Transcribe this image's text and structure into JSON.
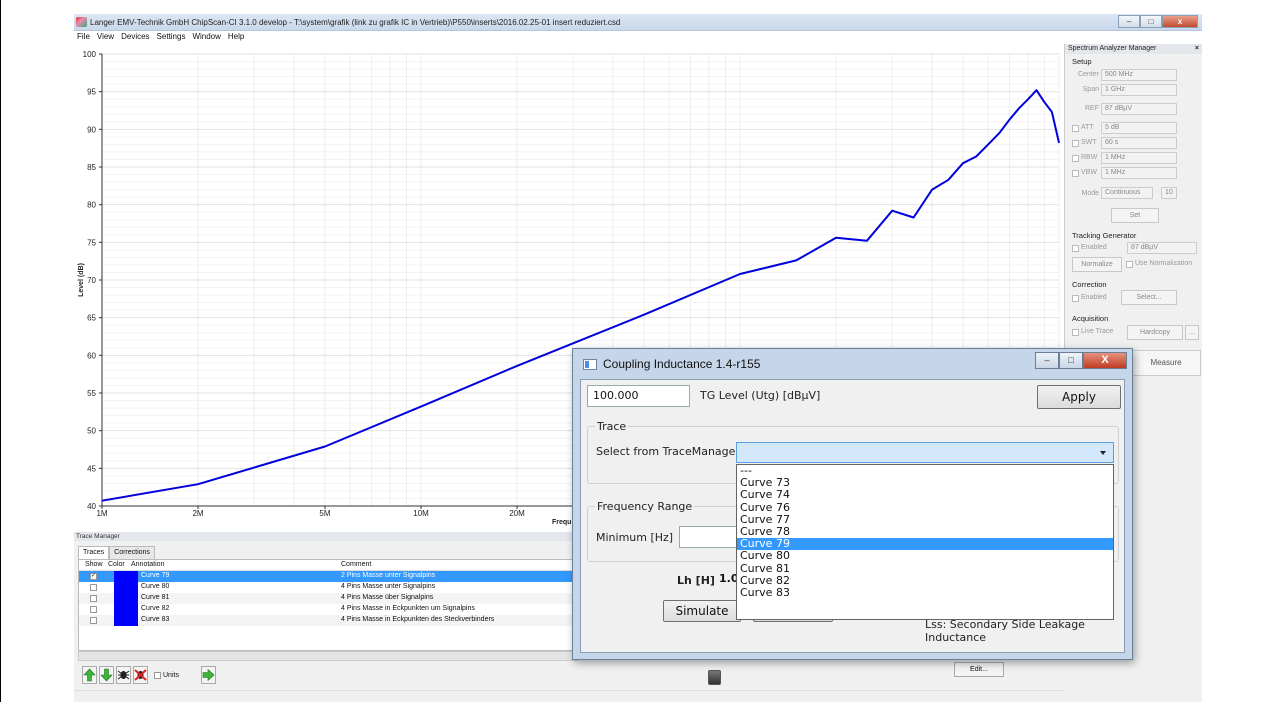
{
  "window": {
    "title": "Langer EMV-Technik GmbH ChipScan-CI 3.1.0 develop  -  T:\\system\\grafik (link zu grafik IC in Vertrieb)\\P550\\inserts\\2016.02.25-01 insert reduziert.csd",
    "buttons": {
      "minimize": "–",
      "maximize": "□",
      "close": "x"
    }
  },
  "menu": [
    "File",
    "View",
    "Devices",
    "Settings",
    "Window",
    "Help"
  ],
  "chart_data": {
    "type": "line",
    "ylabel": "Level (dB)",
    "xlabel": "Frequ",
    "ylim": [
      40,
      100
    ],
    "yticks": [
      40,
      45,
      50,
      55,
      60,
      65,
      70,
      75,
      80,
      85,
      90,
      95,
      100
    ],
    "xscale": "log",
    "xticks": [
      {
        "label": "1M",
        "value": 1000000
      },
      {
        "label": "2M",
        "value": 2000000
      },
      {
        "label": "5M",
        "value": 5000000
      },
      {
        "label": "10M",
        "value": 10000000
      },
      {
        "label": "20M",
        "value": 20000000
      }
    ],
    "grid": true,
    "line_color": "#0000dd",
    "series": [
      {
        "x": [
          1000000,
          2000000,
          5000000,
          10000000,
          20000000,
          50000000,
          100000000,
          150000000,
          200000000,
          250000000,
          300000000,
          350000000,
          400000000,
          450000000,
          500000000,
          550000000,
          600000000,
          650000000,
          700000000,
          750000000,
          800000000,
          850000000,
          900000000,
          950000000,
          1000000000
        ],
        "y": [
          40.7,
          42.9,
          47.9,
          53.2,
          58.6,
          65.4,
          70.8,
          72.6,
          75.6,
          75.2,
          79.2,
          78.3,
          82.0,
          83.3,
          85.5,
          86.4,
          88.0,
          89.5,
          91.3,
          92.8,
          94.0,
          95.2,
          93.6,
          92.3,
          88.2
        ]
      }
    ]
  },
  "spectrum_analyzer": {
    "header": "Spectrum Analyzer Manager",
    "close": "×",
    "setup": "Setup",
    "center_label": "Center",
    "center_value": "500 MHz",
    "span_label": "Span",
    "span_value": "1 GHz",
    "ref_label": "REF",
    "ref_value": "87 dBµV",
    "att_label": "ATT",
    "att_value": "5 dB",
    "swt_label": "SWT",
    "swt_value": "60 s",
    "rbw_label": "RBW",
    "rbw_value": "1 MHz",
    "vbw_label": "VBW",
    "vbw_value": "1 MHz",
    "mode_label": "Mode",
    "mode_value": "Continuous",
    "mode_count": "10",
    "set_button": "Set",
    "tracking_generator": "Tracking Generator",
    "tg_enabled": "Enabled",
    "tg_value": "87 dBµV",
    "normalize_button": "Normalize",
    "use_normalization": "Use Normalization",
    "correction": "Correction",
    "corr_enabled": "Enabled",
    "select_button": "Select...",
    "acquisition": "Acquisition",
    "live_trace": "Live Trace",
    "hardcopy_button": "Hardcopy",
    "more_button": "...",
    "measure_button": "Measure"
  },
  "trace_manager": {
    "header": "Trace Manager",
    "tabs": [
      "Traces",
      "Corrections"
    ],
    "columns": [
      "Show",
      "Color",
      "Annotation",
      "Comment"
    ],
    "rows": [
      {
        "checked": "✓",
        "annotation": "Curve 79",
        "comment": "2 Pins Masse unter Signalpins"
      },
      {
        "checked": "",
        "annotation": "Curve 80",
        "comment": "4 Pins Masse unter Signalpins"
      },
      {
        "checked": "",
        "annotation": "Curve 81",
        "comment": "4 Pins Masse über Signalpins"
      },
      {
        "checked": "",
        "annotation": "Curve 82",
        "comment": "4 Pins Masse in Eckpunkten um Signalpins"
      },
      {
        "checked": "",
        "annotation": "Curve 83",
        "comment": "4 Pins Masse in Eckpunkten des Steckverbinders"
      }
    ],
    "units_label": "Units",
    "edit_button": "Edit..."
  },
  "dialog": {
    "title": "Coupling Inductance 1.4-r155",
    "buttons": {
      "minimize": "–",
      "maximize": "□",
      "close": "X"
    },
    "tg_level_value": "100.000",
    "tg_level_label": "TG Level (Utg) [dBµV]",
    "apply_button": "Apply",
    "trace_group": "Trace",
    "select_label": "Select from TraceManager",
    "dropdown_options": [
      "---",
      "Curve 73",
      "Curve 74",
      "Curve 76",
      "Curve 77",
      "Curve 78",
      "Curve 79",
      "Curve 80",
      "Curve 81",
      "Curve 82",
      "Curve 83"
    ],
    "dropdown_selected": "Curve 79",
    "frequency_group": "Frequency Range",
    "minimum_label": "Minimum [Hz]",
    "lh_label": "Lh [H]",
    "lh_value_partial": "1.0",
    "simulate_button": "Simulate",
    "lss_note": "Lss: Secondary Side Leakage Inductance"
  }
}
